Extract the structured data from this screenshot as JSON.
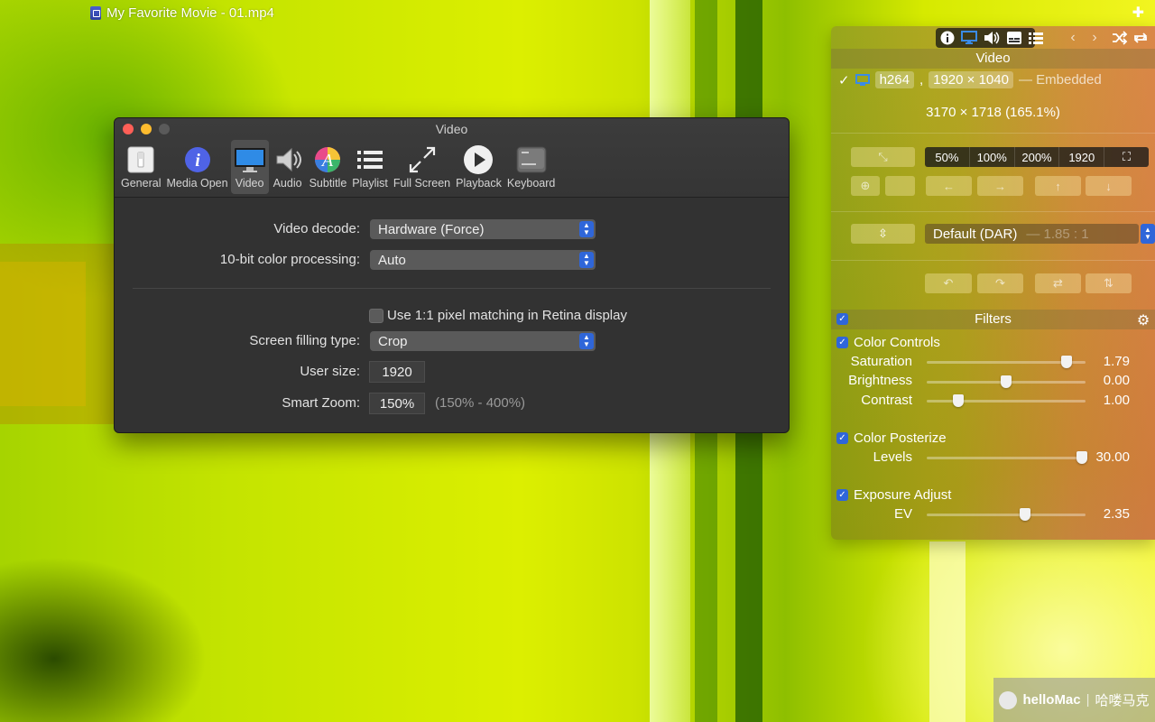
{
  "player": {
    "movie_title": "My Favorite Movie - 01.mp4"
  },
  "prefs": {
    "title": "Video",
    "toolbar": [
      {
        "label": "General",
        "icon": "switch-icon"
      },
      {
        "label": "Media Open",
        "icon": "info-icon"
      },
      {
        "label": "Video",
        "icon": "monitor-icon"
      },
      {
        "label": "Audio",
        "icon": "speaker-icon"
      },
      {
        "label": "Subtitle",
        "icon": "font-icon"
      },
      {
        "label": "Playlist",
        "icon": "list-icon"
      },
      {
        "label": "Full Screen",
        "icon": "fullscreen-icon"
      },
      {
        "label": "Playback",
        "icon": "play-icon"
      },
      {
        "label": "Keyboard",
        "icon": "keyboard-icon"
      }
    ],
    "active_tab": "Video",
    "video_decode_label": "Video decode:",
    "video_decode_value": "Hardware (Force)",
    "color_processing_label": "10-bit color processing:",
    "color_processing_value": "Auto",
    "pixel_matching_label": "Use 1:1 pixel matching in Retina display",
    "screen_fill_label": "Screen filling type:",
    "screen_fill_value": "Crop",
    "user_size_label": "User size:",
    "user_size_value": "1920",
    "smart_zoom_label": "Smart Zoom:",
    "smart_zoom_value": "150%",
    "smart_zoom_hint": "(150% - 400%)"
  },
  "panel": {
    "video_title": "Video",
    "codec": "h264",
    "sep": ",",
    "dimensions": "1920 × 1040",
    "embedded": "— Embedded",
    "output_res": "3170 × 1718 (165.1%)",
    "scale_options": [
      "50%",
      "100%",
      "200%",
      "1920"
    ],
    "aspect_value": "Default (DAR)",
    "aspect_hint": "— 1.85 : 1",
    "filters_title": "Filters",
    "color_controls": {
      "name": "Color Controls",
      "sliders": [
        {
          "label": "Saturation",
          "value": "1.79",
          "pos": 0.88
        },
        {
          "label": "Brightness",
          "value": "0.00",
          "pos": 0.5
        },
        {
          "label": "Contrast",
          "value": "1.00",
          "pos": 0.2
        }
      ]
    },
    "color_posterize": {
      "name": "Color Posterize",
      "sliders": [
        {
          "label": "Levels",
          "value": "30.00",
          "pos": 0.98
        }
      ]
    },
    "exposure_adjust": {
      "name": "Exposure Adjust",
      "sliders": [
        {
          "label": "EV",
          "value": "2.35",
          "pos": 0.62
        }
      ]
    }
  },
  "watermark": {
    "brand": "helloMac",
    "cn": "哈喽马克"
  }
}
